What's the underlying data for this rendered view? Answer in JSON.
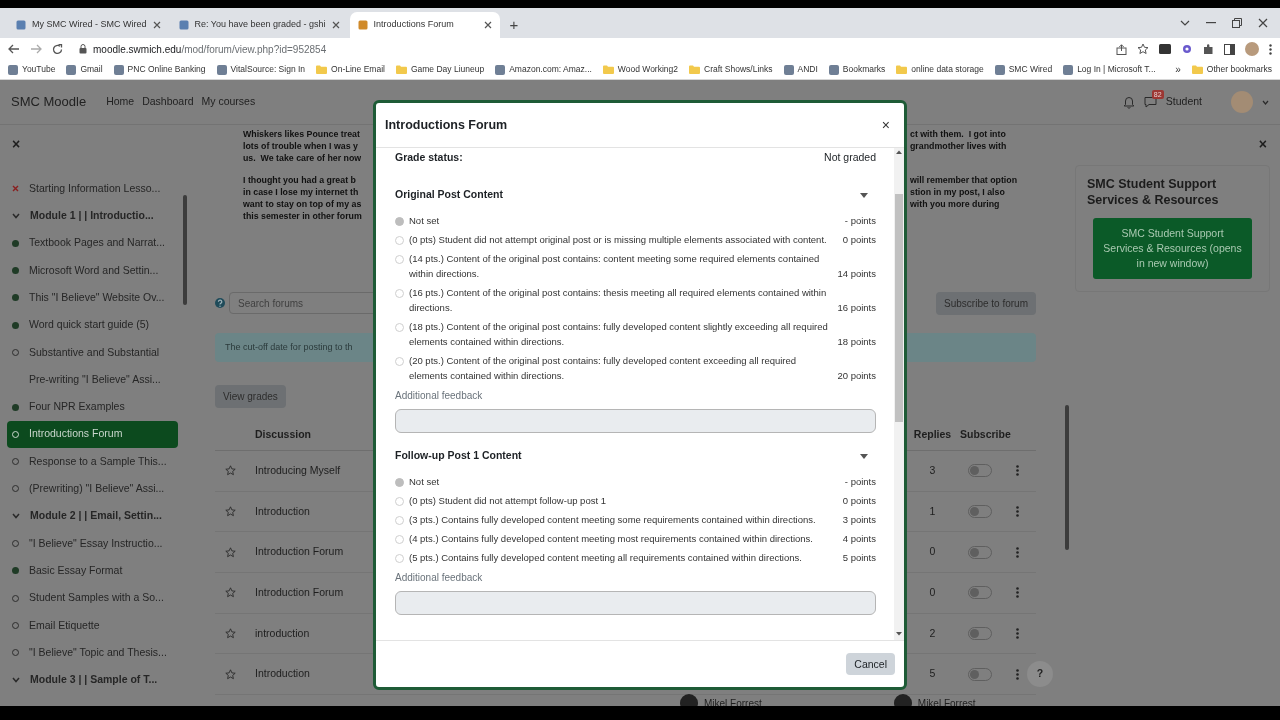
{
  "browser": {
    "tabs": [
      {
        "title": "My SMC Wired - SMC Wired",
        "selected": false
      },
      {
        "title": "Re: You have been graded - gshi",
        "selected": false
      },
      {
        "title": "Introductions Forum",
        "selected": true
      }
    ],
    "new_tab": "+",
    "address": {
      "host": "moodle.swmich.edu",
      "path": "/mod/forum/view.php?id=952854"
    },
    "bookmarks": [
      {
        "label": "YouTube",
        "kind": "link"
      },
      {
        "label": "Gmail",
        "kind": "link"
      },
      {
        "label": "PNC Online Banking",
        "kind": "link"
      },
      {
        "label": "VitalSource: Sign In",
        "kind": "link"
      },
      {
        "label": "On-Line Email",
        "kind": "folder"
      },
      {
        "label": "Game Day Liuneup",
        "kind": "folder"
      },
      {
        "label": "Amazon.com: Amaz...",
        "kind": "link"
      },
      {
        "label": "Wood Working2",
        "kind": "folder"
      },
      {
        "label": "Craft Shows/Links",
        "kind": "folder"
      },
      {
        "label": "ANDI",
        "kind": "link"
      },
      {
        "label": "Bookmarks",
        "kind": "link"
      },
      {
        "label": "online data storage",
        "kind": "folder"
      },
      {
        "label": "SMC Wired",
        "kind": "link"
      },
      {
        "label": "Log In | Microsoft T...",
        "kind": "link"
      }
    ],
    "more_bookmarks": "»",
    "other_bookmarks": "Other bookmarks"
  },
  "navbar": {
    "brand": "SMC Moodle",
    "links": [
      "Home",
      "Dashboard",
      "My courses"
    ],
    "message_count": "82",
    "user": "Student"
  },
  "course_index": {
    "close": "×",
    "items": [
      {
        "label": "Starting Information Lesso...",
        "kind": "failed",
        "selected": false
      },
      {
        "label": "Module 1 | | Introductio...",
        "kind": "section",
        "expanded": true,
        "selected": false
      },
      {
        "label": "Textbook Pages and Narrat...",
        "kind": "done",
        "selected": false
      },
      {
        "label": "Microsoft Word and Settin...",
        "kind": "done",
        "selected": false
      },
      {
        "label": "This \"I Believe\" Website Ov...",
        "kind": "done",
        "selected": false
      },
      {
        "label": "Word quick start guide (5)",
        "kind": "done",
        "selected": false
      },
      {
        "label": "Substantive and Substantial",
        "kind": "todo",
        "selected": false
      },
      {
        "label": "Pre-writing \"I Believe\" Assi...",
        "kind": "plain",
        "selected": false
      },
      {
        "label": "Four NPR Examples",
        "kind": "done",
        "selected": false
      },
      {
        "label": "Introductions Forum",
        "kind": "todo",
        "selected": true
      },
      {
        "label": "Response to a Sample This...",
        "kind": "todo",
        "selected": false
      },
      {
        "label": "(Prewriting) \"I Believe\" Assi...",
        "kind": "todo",
        "selected": false
      },
      {
        "label": "Module 2 | | Email, Settin...",
        "kind": "section",
        "expanded": true,
        "selected": false
      },
      {
        "label": "\"I Believe\" Essay Instructio...",
        "kind": "todo",
        "selected": false
      },
      {
        "label": "Basic Essay Format",
        "kind": "done",
        "selected": false
      },
      {
        "label": "Student Samples with a So...",
        "kind": "todo",
        "selected": false
      },
      {
        "label": "Email Etiquette",
        "kind": "todo",
        "selected": false
      },
      {
        "label": "\"I Believe\" Topic and Thesis...",
        "kind": "todo",
        "selected": false
      },
      {
        "label": "Module 3 | | Sample of T...",
        "kind": "section",
        "expanded": true,
        "selected": false
      }
    ]
  },
  "post_excerpt": [
    {
      "left": [
        "Whiskers likes Pounce treat",
        "lots of trouble when I was y",
        "us.  We take care of her now"
      ],
      "right": [
        "ct with them.  I got into",
        "grandmother lives with"
      ]
    },
    {
      "left": [
        "I thought you had a great b",
        "in case I lose my internet th",
        "want to stay on top of my as",
        "this semester in other forum"
      ],
      "right": [
        "will remember that option",
        "stion in my post, I also",
        "with you more during"
      ]
    }
  ],
  "search": {
    "placeholder": "Search forums"
  },
  "subscribe_button": "Subscribe to forum",
  "notice": "The cut-off date for posting to th",
  "view_grades": "View grades",
  "discussions": {
    "columns": [
      "Discussion",
      "Replies",
      "Subscribe"
    ],
    "rows": [
      {
        "title": "Introducing Myself",
        "replies": "3",
        "subscribed": false,
        "starred": false
      },
      {
        "title": "Introduction",
        "replies": "1",
        "subscribed": false,
        "starred": false
      },
      {
        "title": "Introduction Forum",
        "replies": "0",
        "subscribed": false,
        "starred": false
      },
      {
        "title": "Introduction Forum",
        "replies": "0",
        "subscribed": false,
        "starred": false
      },
      {
        "title": "introduction",
        "replies": "2",
        "subscribed": false,
        "starred": false
      },
      {
        "title": "Introduction",
        "replies": "5",
        "subscribed": false,
        "starred": false
      }
    ],
    "next_row_authors": [
      "Mikel Forrest",
      "Mikel Forrest"
    ]
  },
  "block": {
    "close": "×",
    "title": "SMC Student Support Services & Resources",
    "button": "SMC Student Support Services & Resources (opens in new window)"
  },
  "help_button": "?",
  "modal": {
    "title": "Introductions Forum",
    "close": "×",
    "grade_status": {
      "label": "Grade status:",
      "value": "Not graded"
    },
    "criteria": [
      {
        "title": "Original Post Content",
        "expanded": true,
        "feedback_label": "Additional feedback",
        "options": [
          {
            "label": "Not set",
            "points": "- points",
            "selected": true
          },
          {
            "label": "(0 pts) Student did not attempt original post or is missing multiple elements associated with content.",
            "points": "0 points",
            "selected": false
          },
          {
            "label": "(14 pts.) Content of the original post contains: content meeting some required elements contained within directions.",
            "points": "14 points",
            "selected": false
          },
          {
            "label": "(16 pts.) Content of the original post contains: thesis meeting all required elements contained within directions.",
            "points": "16 points",
            "selected": false
          },
          {
            "label": "(18 pts.) Content of the original post contains: fully developed content slightly exceeding all required elements contained within directions.",
            "points": "18 points",
            "selected": false
          },
          {
            "label": "(20 pts.) Content of the original post contains: fully developed content exceeding all required elements contained within directions.",
            "points": "20 points",
            "selected": false
          }
        ]
      },
      {
        "title": "Follow-up Post 1 Content",
        "expanded": true,
        "feedback_label": "Additional feedback",
        "options": [
          {
            "label": "Not set",
            "points": "- points",
            "selected": true
          },
          {
            "label": "(0 pts) Student did not attempt follow-up post 1",
            "points": "0 points",
            "selected": false
          },
          {
            "label": "(3 pts.) Contains fully developed content meeting some requirements contained within directions.",
            "points": "3 points",
            "selected": false
          },
          {
            "label": "(4 pts.) Contains fully developed content meeting most requirements contained within directions.",
            "points": "4 points",
            "selected": false
          },
          {
            "label": "(5 pts.) Contains fully developed content meeting all requirements contained within directions.",
            "points": "5 points",
            "selected": false
          }
        ]
      }
    ],
    "cancel": "Cancel"
  }
}
